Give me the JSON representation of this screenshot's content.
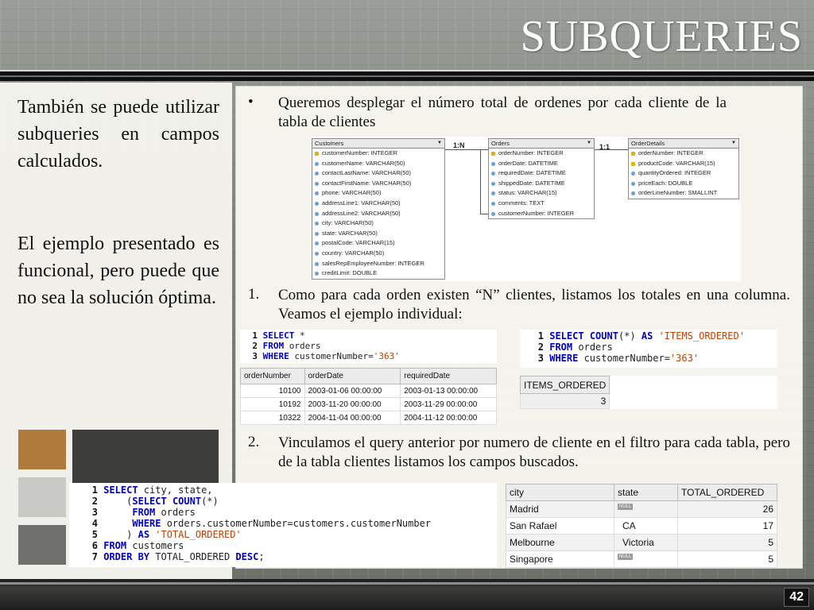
{
  "slide": {
    "title": "SUBQUERIES",
    "page_number": "42"
  },
  "left": {
    "paragraph1": "También se puede utilizar subqueries en campos calculados.",
    "paragraph2": "El ejemplo presentado es funcional, pero puede que no sea la solución óptima.",
    "square_colors": [
      "#b07a3a",
      "#3d3e3c",
      "#c9c9c5",
      "#5a5b59",
      "#6f6f6b"
    ]
  },
  "right": {
    "bullet_marker": "•",
    "bullet_text": "Queremos desplegar el número total de ordenes por cada cliente de la tabla de clientes",
    "item1_marker": "1.",
    "item1_text": "Como para cada orden existen “N” clientes, listamos los totales en una columna.  Veamos el ejemplo individual:",
    "item2_marker": "2.",
    "item2_text": "Vinculamos el query anterior por numero de cliente en el filtro para cada tabla, pero de la tabla clientes listamos los campos buscados."
  },
  "erd": {
    "customers": {
      "name": "Customers",
      "fields": [
        "customerNumber: INTEGER",
        "customerName: VARCHAR(50)",
        "contactLastName: VARCHAR(50)",
        "contactFirstName: VARCHAR(50)",
        "phone: VARCHAR(50)",
        "addressLine1: VARCHAR(50)",
        "addressLine2: VARCHAR(50)",
        "city: VARCHAR(50)",
        "state: VARCHAR(50)",
        "postalCode: VARCHAR(15)",
        "country: VARCHAR(50)",
        "salesRepEmployeeNumber: INTEGER",
        "creditLimit: DOUBLE"
      ]
    },
    "orders": {
      "name": "Orders",
      "fields": [
        "orderNumber: INTEGER",
        "orderDate: DATETIME",
        "requiredDate: DATETIME",
        "shippedDate: DATETIME",
        "status: VARCHAR(15)",
        "comments: TEXT",
        "customerNumber: INTEGER"
      ]
    },
    "orderdetails": {
      "name": "OrderDetails",
      "fields": [
        "orderNumber: INTEGER",
        "productCode: VARCHAR(15)",
        "quantityOrdered: INTEGER",
        "priceEach: DOUBLE",
        "orderLineNumber: SMALLINT"
      ]
    },
    "rel1": "1:N",
    "rel2": "1:1"
  },
  "query1": {
    "lines": [
      {
        "n": "1",
        "kw": "SELECT",
        "rest": " *"
      },
      {
        "n": "2",
        "kw": "FROM",
        "rest": " orders"
      },
      {
        "n": "3",
        "kw": "WHERE",
        "rest": " customerNumber=",
        "str": "'363'"
      }
    ],
    "headers": [
      "orderNumber",
      "orderDate",
      "requiredDate"
    ],
    "rows": [
      [
        "10100",
        "2003-01-06 00:00:00",
        "2003-01-13 00:00:00"
      ],
      [
        "10192",
        "2003-11-20 00:00:00",
        "2003-11-29 00:00:00"
      ],
      [
        "10322",
        "2004-11-04 00:00:00",
        "2004-11-12 00:00:00"
      ]
    ]
  },
  "query2": {
    "line1_n": "1",
    "line1_kw": "SELECT",
    "line1_fn": "COUNT",
    "line1_args": "(*) ",
    "line1_as": "AS",
    "line1_str": "'ITEMS_ORDERED'",
    "line2_n": "2",
    "line2_kw": "FROM",
    "line2_rest": " orders",
    "line3_n": "3",
    "line3_kw": "WHERE",
    "line3_rest": " customerNumber=",
    "line3_str": "'363'",
    "header": "ITEMS_ORDERED",
    "value": "3"
  },
  "query3": {
    "n1": "1",
    "l1_kw": "SELECT",
    "l1_rest": " city, state,",
    "n2": "2",
    "l2_pre": "    (",
    "l2_kw": "SELECT",
    "l2_fn": " COUNT",
    "l2_rest": "(*)",
    "n3": "3",
    "l3_pre": "     ",
    "l3_kw": "FROM",
    "l3_rest": " orders",
    "n4": "4",
    "l4_pre": "     ",
    "l4_kw": "WHERE",
    "l4_rest": " orders.customerNumber=customers.customerNumber",
    "n5": "5",
    "l5_pre": "    ) ",
    "l5_kw": "AS",
    "l5_str": " 'TOTAL_ORDERED'",
    "n6": "6",
    "l6_kw": "FROM",
    "l6_rest": " customers",
    "n7": "7",
    "l7_kw": "ORDER BY",
    "l7_rest": " TOTAL_ORDERED ",
    "l7_kw2": "DESC",
    "l7_end": ";",
    "headers": [
      "city",
      "state",
      "TOTAL_ORDERED"
    ],
    "null_label": "NULL",
    "rows": [
      {
        "city": "Madrid",
        "state": "",
        "state_null": true,
        "total": "26"
      },
      {
        "city": "San Rafael",
        "state": "CA",
        "state_null": false,
        "total": "17"
      },
      {
        "city": "Melbourne",
        "state": "Victoria",
        "state_null": false,
        "total": "5"
      },
      {
        "city": "Singapore",
        "state": "",
        "state_null": true,
        "total": "5"
      }
    ]
  }
}
